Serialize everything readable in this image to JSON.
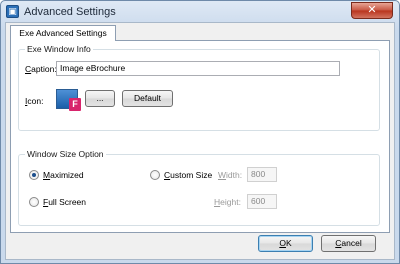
{
  "window": {
    "title": "Advanced Settings",
    "close_glyph": "✕",
    "app_icon": "app-icon"
  },
  "tabs": [
    {
      "label": "Exe Advanced Settings",
      "active": true
    }
  ],
  "exe_window_info": {
    "legend": "Exe Window Info",
    "caption_label_prefix": "C",
    "caption_label_rest": "aption:",
    "caption_value": "Image eBrochure",
    "icon_label_prefix": "I",
    "icon_label_rest": "con:",
    "browse_label": "...",
    "default_label": "Default"
  },
  "window_size": {
    "legend": "Window Size Option",
    "maximized_prefix": "M",
    "maximized_rest": "aximized",
    "maximized_checked": true,
    "fullscreen_prefix": "F",
    "fullscreen_rest": "ull Screen",
    "custom_prefix": "C",
    "custom_rest": "ustom Size",
    "width_prefix": "W",
    "width_rest": "idth:",
    "width_value": "800",
    "height_prefix": "H",
    "height_rest": "eight:",
    "height_value": "600"
  },
  "footer": {
    "ok_prefix": "O",
    "ok_rest": "K",
    "cancel_prefix": "C",
    "cancel_rest": "ancel"
  }
}
